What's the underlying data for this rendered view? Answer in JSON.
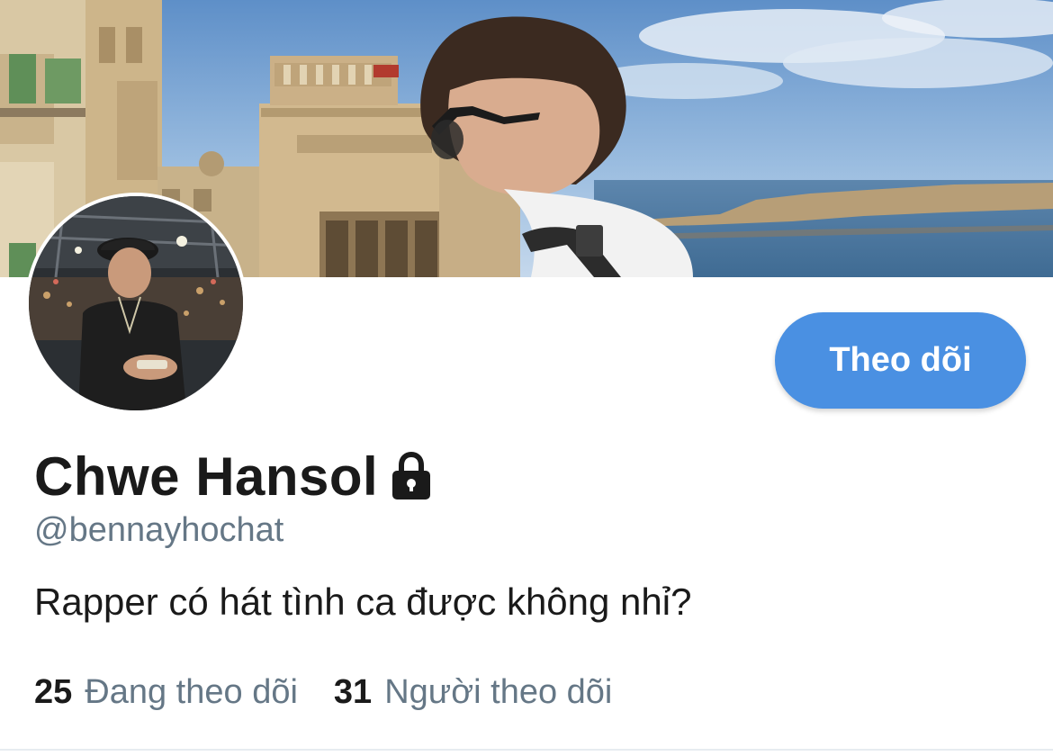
{
  "profile": {
    "display_name": "Chwe Hansol",
    "handle": "@bennayhochat",
    "bio": "Rapper có hát tình ca được không nhỉ?",
    "protected_icon": "lock-icon"
  },
  "actions": {
    "follow_label": "Theo dõi"
  },
  "stats": {
    "following_count": "25",
    "following_label": "Đang theo dõi",
    "followers_count": "31",
    "followers_label": "Người theo dõi"
  },
  "colors": {
    "accent": "#4a90e2",
    "secondary_text": "#657786",
    "primary_text": "#1a1a1a"
  }
}
